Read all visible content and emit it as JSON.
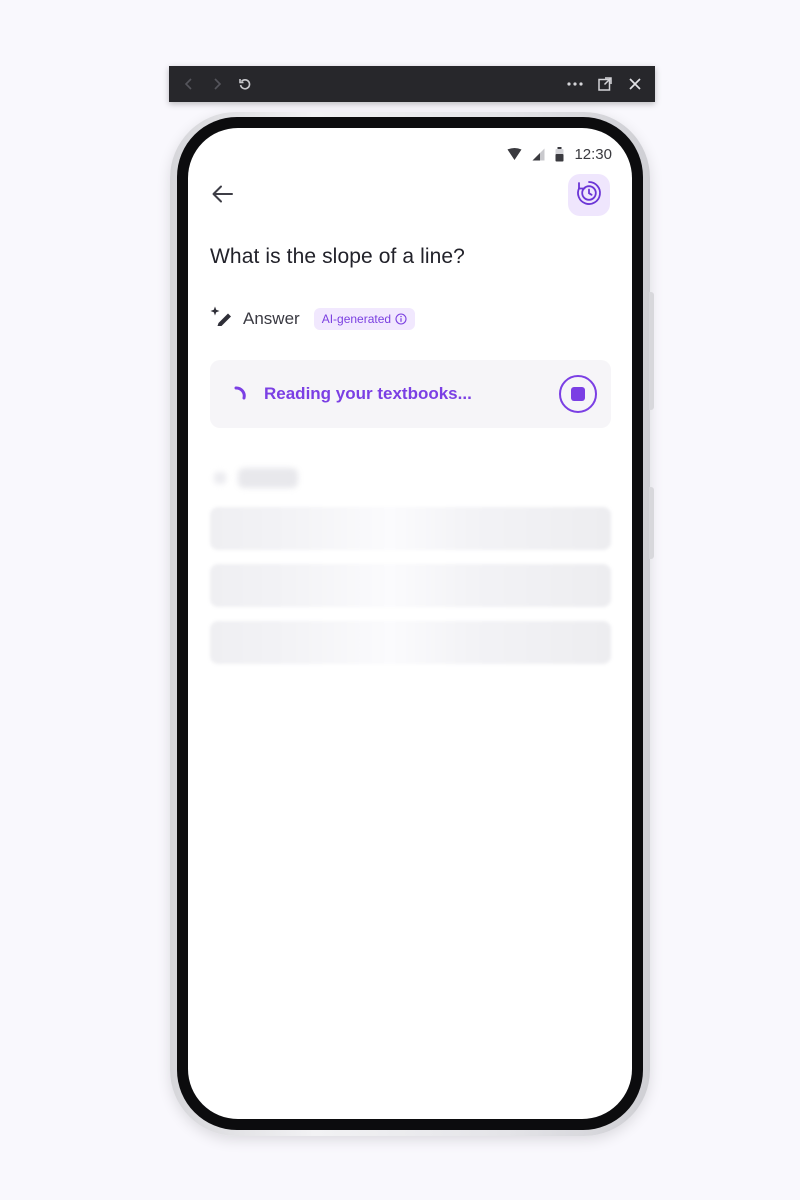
{
  "emulator_toolbar": {
    "back_icon": "chevron-left-icon",
    "forward_icon": "chevron-right-icon",
    "refresh_icon": "refresh-icon",
    "more_icon": "more-horizontal-icon",
    "popout_icon": "external-window-icon",
    "close_icon": "close-icon"
  },
  "status_bar": {
    "time": "12:30",
    "icons": [
      "wifi-icon",
      "signal-icon",
      "battery-icon"
    ]
  },
  "header": {
    "back_icon": "arrow-left-icon",
    "history_icon": "history-clock-icon"
  },
  "question": {
    "title": "What is the slope of a line?"
  },
  "answer": {
    "icon": "sparkle-pen-icon",
    "label": "Answer",
    "badge": "AI-generated"
  },
  "loading": {
    "text": "Reading your textbooks...",
    "stop_icon": "stop-icon"
  },
  "colors": {
    "accent": "#7b3fe4",
    "accent_light": "#efe6fd",
    "text_primary": "#22222a",
    "card_bg": "#f6f5f8",
    "toolbar_bg": "#27272b"
  }
}
